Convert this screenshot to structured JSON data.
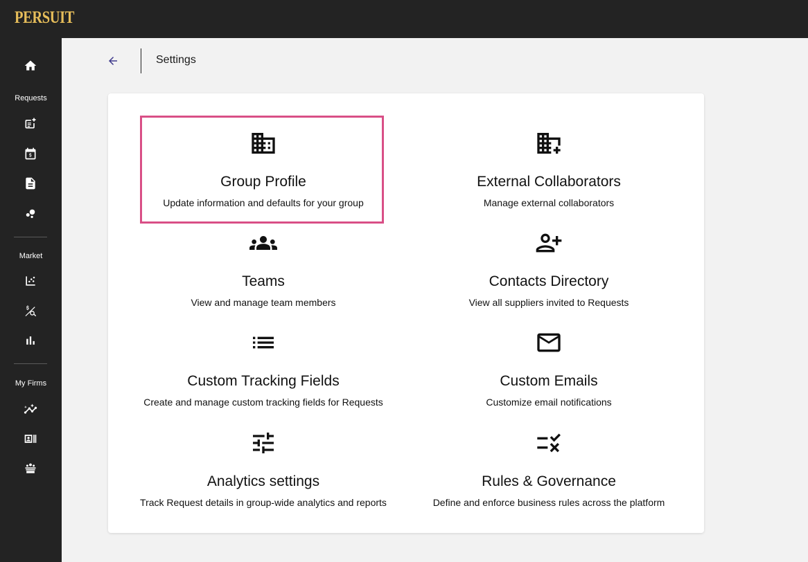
{
  "app": {
    "logo": "PERSUIT"
  },
  "sidebar": {
    "sections": [
      {
        "label": "Requests"
      },
      {
        "label": "Market"
      },
      {
        "label": "My Firms"
      }
    ]
  },
  "header": {
    "title": "Settings"
  },
  "colors": {
    "highlight": "#d94f86",
    "logo": "#e6bd5a",
    "sidebar": "#232323",
    "back_arrow": "#3f3a8c"
  },
  "settings": [
    {
      "icon": "business-icon",
      "title": "Group Profile",
      "description": "Update information and defaults for your group"
    },
    {
      "icon": "add-business-icon",
      "title": "External Collaborators",
      "description": "Manage external collaborators"
    },
    {
      "icon": "groups-icon",
      "title": "Teams",
      "description": "View and manage team members"
    },
    {
      "icon": "person-add-icon",
      "title": "Contacts Directory",
      "description": "View all suppliers invited to Requests"
    },
    {
      "icon": "list-icon",
      "title": "Custom Tracking Fields",
      "description": "Create and manage custom tracking fields for Requests"
    },
    {
      "icon": "mail-icon",
      "title": "Custom Emails",
      "description": "Customize email notifications"
    },
    {
      "icon": "tune-icon",
      "title": "Analytics settings",
      "description": "Track Request details in group-wide analytics and reports"
    },
    {
      "icon": "rule-icon",
      "title": "Rules & Governance",
      "description": "Define and enforce business rules across the platform"
    }
  ]
}
